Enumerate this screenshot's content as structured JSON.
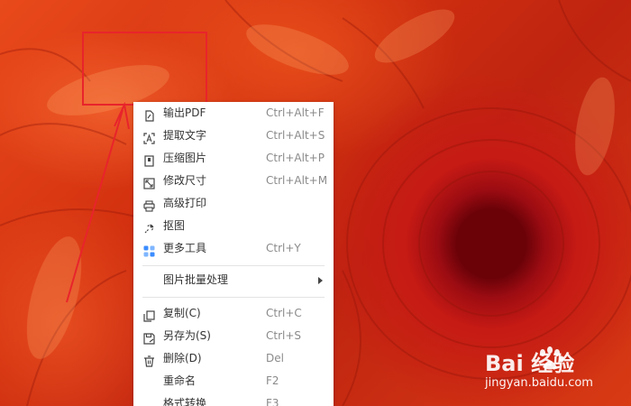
{
  "menu": {
    "items": [
      {
        "icon": "pdf-export-icon",
        "label": "输出PDF",
        "shortcut": "Ctrl+Alt+F"
      },
      {
        "icon": "text-extract-icon",
        "label": "提取文字",
        "shortcut": "Ctrl+Alt+S"
      },
      {
        "icon": "compress-icon",
        "label": "压缩图片",
        "shortcut": "Ctrl+Alt+P"
      },
      {
        "icon": "resize-icon",
        "label": "修改尺寸",
        "shortcut": "Ctrl+Alt+M"
      },
      {
        "icon": "printer-icon",
        "label": "高级打印",
        "shortcut": ""
      },
      {
        "icon": "cutout-icon",
        "label": "抠图",
        "shortcut": ""
      },
      {
        "icon": "more-tools-icon",
        "label": "更多工具",
        "shortcut": "Ctrl+Y"
      }
    ],
    "batch": {
      "label": "图片批量处理"
    },
    "file_items": [
      {
        "icon": "copy-icon",
        "label": "复制(C)",
        "shortcut": "Ctrl+C"
      },
      {
        "icon": "save-as-icon",
        "label": "另存为(S)",
        "shortcut": "Ctrl+S"
      },
      {
        "icon": "delete-icon",
        "label": "删除(D)",
        "shortcut": "Del"
      },
      {
        "icon": "",
        "label": "重命名",
        "shortcut": "F2"
      },
      {
        "icon": "",
        "label": "格式转换",
        "shortcut": "F3"
      }
    ]
  },
  "watermark": {
    "brand": "Bai  经验",
    "site": "jingyan.baidu.com"
  },
  "colors": {
    "highlight": "#e8242b",
    "menu_bg": "#ffffff",
    "more_tools_accent": "#3b8cff"
  }
}
